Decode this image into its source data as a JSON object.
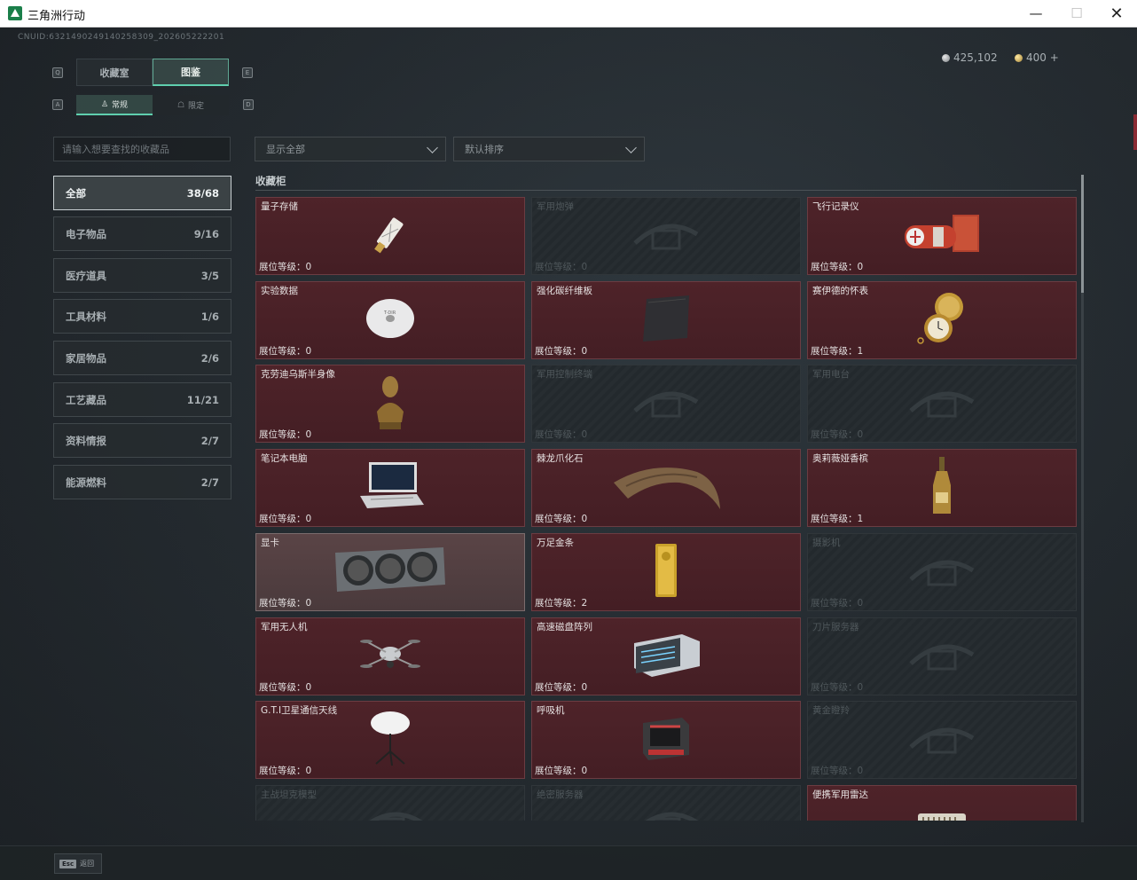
{
  "window": {
    "title": "三角洲行动",
    "min_icon": "—",
    "max_icon": "☐",
    "close_icon": "✕"
  },
  "uid": "CNUID:6321490249140258309_202605222201",
  "currency": [
    {
      "icon": "silver-coin-icon",
      "value": "425,102"
    },
    {
      "icon": "gold-coin-icon",
      "value": "400 +"
    }
  ],
  "tabs": {
    "key_left": "Q",
    "key_right": "E",
    "items": [
      {
        "label": "收藏室",
        "active": false
      },
      {
        "label": "图鉴",
        "active": true
      }
    ]
  },
  "subtabs": {
    "key_left": "A",
    "key_right": "D",
    "items": [
      {
        "label": "常规",
        "icon": "figure-icon",
        "active": true
      },
      {
        "label": "限定",
        "icon": "limited-icon",
        "active": false
      }
    ]
  },
  "search": {
    "placeholder": "请输入想要查找的收藏品"
  },
  "filters": {
    "display": "显示全部",
    "sort": "默认排序"
  },
  "categories": [
    {
      "label": "全部",
      "count": "38/68",
      "active": true
    },
    {
      "label": "电子物品",
      "count": "9/16",
      "active": false
    },
    {
      "label": "医疗道具",
      "count": "3/5",
      "active": false
    },
    {
      "label": "工具材料",
      "count": "1/6",
      "active": false
    },
    {
      "label": "家居物品",
      "count": "2/6",
      "active": false
    },
    {
      "label": "工艺藏品",
      "count": "11/21",
      "active": false
    },
    {
      "label": "资料情报",
      "count": "2/7",
      "active": false
    },
    {
      "label": "能源燃料",
      "count": "2/7",
      "active": false
    }
  ],
  "section_title": "收藏柜",
  "cards": [
    {
      "name": "量子存储",
      "level": "展位等级：0",
      "state": "owned",
      "art": "usb-drive-icon"
    },
    {
      "name": "军用炮弹",
      "level": "展位等级：0",
      "state": "locked",
      "art": "shell-icon"
    },
    {
      "name": "飞行记录仪",
      "level": "展位等级：0",
      "state": "owned",
      "art": "flight-recorder-icon"
    },
    {
      "name": "实验数据",
      "level": "展位等级：0",
      "state": "owned",
      "art": "disc-icon"
    },
    {
      "name": "强化碳纤维板",
      "level": "展位等级：0",
      "state": "owned",
      "art": "carbon-plate-icon"
    },
    {
      "name": "赛伊德的怀表",
      "level": "展位等级：1",
      "state": "owned",
      "art": "pocket-watch-icon"
    },
    {
      "name": "克劳迪乌斯半身像",
      "level": "展位等级：0",
      "state": "owned",
      "art": "bust-icon"
    },
    {
      "name": "军用控制终端",
      "level": "展位等级：0",
      "state": "locked",
      "art": "terminal-icon"
    },
    {
      "name": "军用电台",
      "level": "展位等级：0",
      "state": "locked",
      "art": "radio-icon"
    },
    {
      "name": "笔记本电脑",
      "level": "展位等级：0",
      "state": "owned",
      "art": "laptop-icon"
    },
    {
      "name": "棘龙爪化石",
      "level": "展位等级：0",
      "state": "owned",
      "art": "claw-fossil-icon"
    },
    {
      "name": "奥莉薇娅香槟",
      "level": "展位等级：1",
      "state": "owned",
      "art": "champagne-icon"
    },
    {
      "name": "显卡",
      "level": "展位等级：0",
      "state": "highlight",
      "art": "graphics-card-icon"
    },
    {
      "name": "万足金条",
      "level": "展位等级：2",
      "state": "owned",
      "art": "gold-bar-icon"
    },
    {
      "name": "摄影机",
      "level": "展位等级：0",
      "state": "locked",
      "art": "camera-icon"
    },
    {
      "name": "军用无人机",
      "level": "展位等级：0",
      "state": "owned",
      "art": "drone-icon"
    },
    {
      "name": "高速磁盘阵列",
      "level": "展位等级：0",
      "state": "owned",
      "art": "disk-array-icon"
    },
    {
      "name": "刀片服务器",
      "level": "展位等级：0",
      "state": "locked",
      "art": "blade-server-icon"
    },
    {
      "name": "G.T.I卫星通信天线",
      "level": "展位等级：0",
      "state": "owned",
      "art": "satellite-antenna-icon"
    },
    {
      "name": "呼吸机",
      "level": "展位等级：0",
      "state": "owned",
      "art": "ventilator-icon"
    },
    {
      "name": "黄金瞪羚",
      "level": "展位等级：0",
      "state": "locked",
      "art": "gazelle-icon"
    },
    {
      "name": "主战坦克模型",
      "level": "",
      "state": "locked",
      "art": "tank-model-icon"
    },
    {
      "name": "绝密服务器",
      "level": "",
      "state": "locked",
      "art": "server-icon"
    },
    {
      "name": "便携军用雷达",
      "level": "",
      "state": "owned",
      "art": "radar-icon"
    }
  ],
  "footer": {
    "key": "Esc",
    "label": "返回"
  }
}
